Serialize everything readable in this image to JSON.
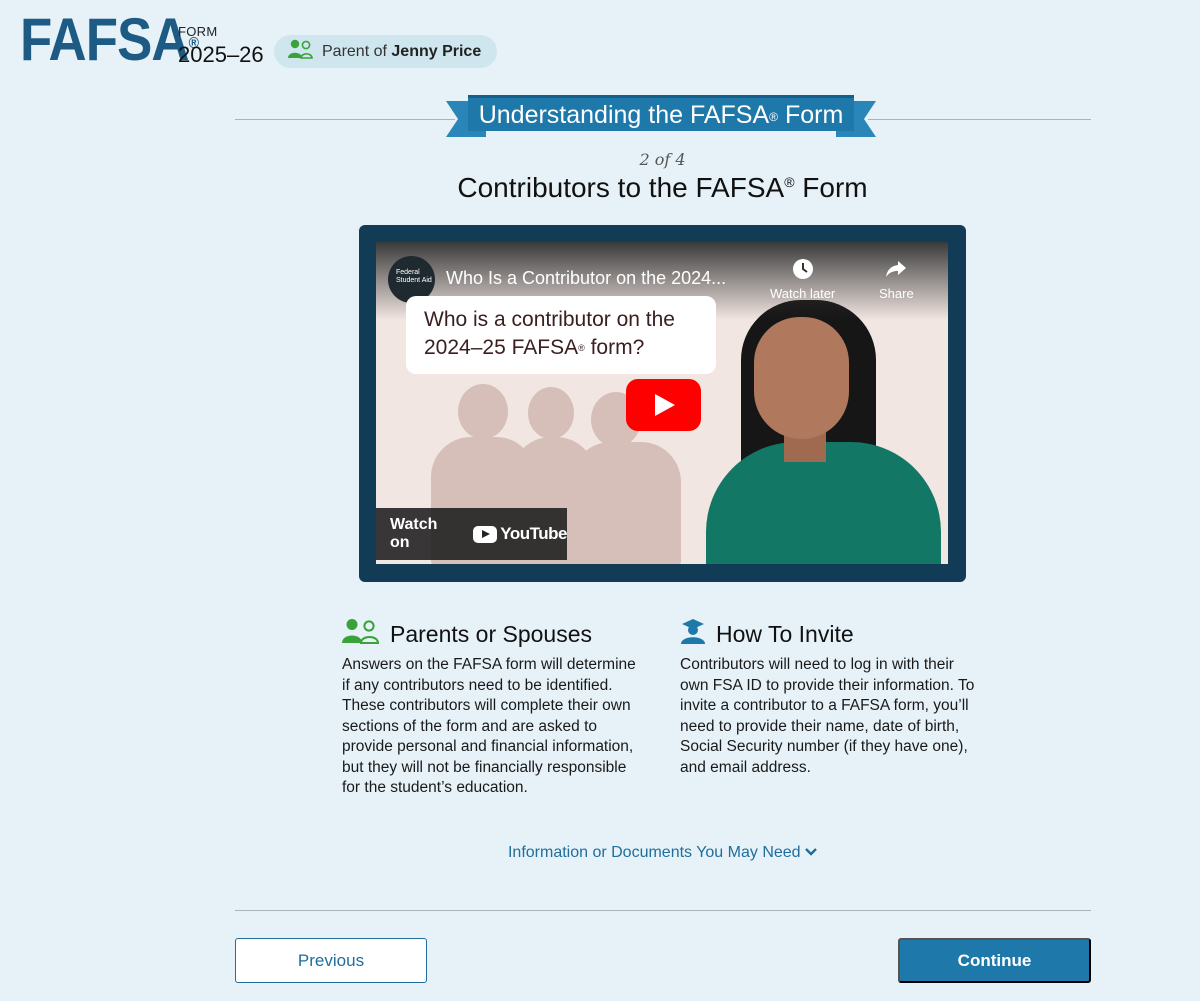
{
  "header": {
    "logo_text": "FAFSA",
    "logo_reg": "®",
    "form_label": "FORM",
    "form_year": "2025–26",
    "role_prefix": "Parent of",
    "student_name": "Jenny Price"
  },
  "banner": {
    "title": "Understanding the FAFSA",
    "reg": "®",
    "suffix": " Form"
  },
  "step_indicator": "2 of 4",
  "page_title": {
    "text": "Contributors to the FAFSA",
    "reg": "®",
    "suffix": " Form"
  },
  "video": {
    "channel_label": "Federal Student Aid",
    "title": "Who Is a Contributor on the 2024...",
    "watch_later": "Watch later",
    "share": "Share",
    "speech_line1": "Who is a contributor on the",
    "speech_line2": "2024–25 FAFSA",
    "speech_reg": "®",
    "speech_suffix": " form?",
    "watch_on": "Watch on",
    "youtube": "YouTube"
  },
  "sections": {
    "parents": {
      "heading": "Parents or Spouses",
      "body": "Answers on the FAFSA form will determine if any contributors need to be identified. These contributors will complete their own sections of the form and are asked to provide personal and financial information, but they will not be financially responsible for the student’s education."
    },
    "invite": {
      "heading": "How To Invite",
      "body": "Contributors will need to log in with their own FSA ID to provide their information. To invite a contributor to a FAFSA form, you’ll need to provide their name, date of birth, Social Security number (if they have one), and email address."
    }
  },
  "docs_link": "Information or Documents You May Need",
  "buttons": {
    "previous": "Previous",
    "continue": "Continue"
  },
  "colors": {
    "brand_blue": "#1f78aa",
    "logo_blue": "#1d5a84",
    "icon_green": "#3aa23a"
  }
}
